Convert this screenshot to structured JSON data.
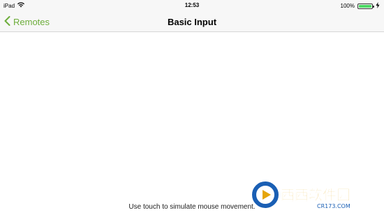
{
  "status_bar": {
    "device": "iPad",
    "time": "12:53",
    "battery": "100%",
    "battery_level": 1.0,
    "icons": [
      "wifi-icon",
      "battery-icon",
      "charging-icon"
    ]
  },
  "nav": {
    "back_label": "Remotes",
    "title": "Basic Input",
    "accent_color": "#6dad3b"
  },
  "main": {
    "hint": "Use touch to simulate mouse movement."
  },
  "watermark": {
    "text": "西西软件园",
    "url": "CR173.COM"
  }
}
